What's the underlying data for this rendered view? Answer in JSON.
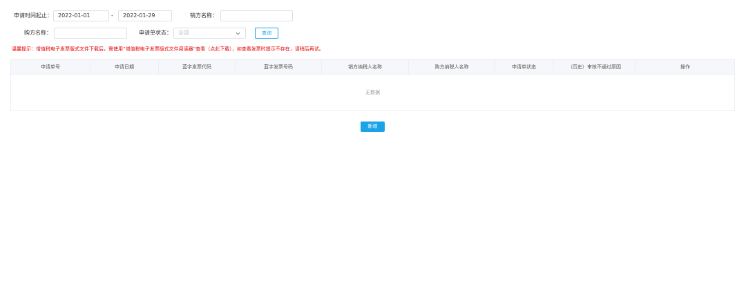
{
  "filters": {
    "date_range_label": "申请时间起止：",
    "start_date": "2022-01-01",
    "date_separator": "-",
    "end_date": "2022-01-29",
    "seller_name_label": "销方名称：",
    "seller_name_value": "",
    "buyer_name_label": "购方名称：",
    "buyer_name_value": "",
    "status_label": "申请单状态：",
    "status_placeholder": "全部",
    "query_button": "查询"
  },
  "tip": "温馨提示：增值税电子发票版式文件下载后，需使用“增值税电子发票版式文件阅读器”查看（点此下载），如查看发票时提示不存在，请稍后再试。",
  "table": {
    "columns": [
      "申请单号",
      "申请日期",
      "蓝字发票代码",
      "蓝字发票号码",
      "销方纳税人名称",
      "购方纳税人名称",
      "申请单状态",
      "（历史）审核不通过原因",
      "操作"
    ],
    "empty_text": "无数据"
  },
  "add_button": "新增",
  "colors": {
    "accent": "#1aa3e8",
    "warning": "#e60000"
  }
}
